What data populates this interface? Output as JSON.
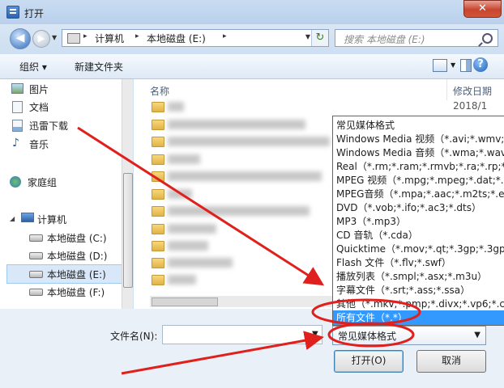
{
  "window": {
    "title": "打开",
    "close_label": "✕"
  },
  "address": {
    "crumbs": [
      "计算机",
      "本地磁盘 (E:)"
    ],
    "search_placeholder": "搜索 本地磁盘 (E:)"
  },
  "toolbar": {
    "organize_label": "组织 ▾",
    "new_folder_label": "新建文件夹"
  },
  "nav": {
    "items": [
      {
        "label": "图片",
        "icon": "pictures-icon"
      },
      {
        "label": "文档",
        "icon": "documents-icon"
      },
      {
        "label": "迅雷下载",
        "icon": "download-icon"
      },
      {
        "label": "音乐",
        "icon": "music-icon"
      },
      {
        "label": "家庭组",
        "icon": "homegroup-icon"
      },
      {
        "label": "计算机",
        "icon": "computer-icon"
      },
      {
        "label": "本地磁盘 (C:)",
        "icon": "drive-icon"
      },
      {
        "label": "本地磁盘 (D:)",
        "icon": "drive-icon"
      },
      {
        "label": "本地磁盘 (E:)",
        "icon": "drive-icon",
        "selected": true
      },
      {
        "label": "本地磁盘 (F:)",
        "icon": "drive-icon"
      }
    ]
  },
  "filelist": {
    "col_name": "名称",
    "col_date": "修改日期",
    "first_date": "2018/1"
  },
  "bottom": {
    "filename_label": "文件名(N):",
    "filter_value": "常见媒体格式",
    "open_label": "打开(O)",
    "cancel_label": "取消"
  },
  "filter_options": [
    "常见媒体格式",
    "Windows Media 视频（*.avi;*.wmv;*.w",
    "Windows Media 音频（*.wma;*.wav;*.",
    "Real（*.rm;*.ram;*.rmvb;*.ra;*.rp;*.smi",
    "MPEG 视频（*.mpg;*.mpeg;*.dat;*.m",
    "MPEG音频（*.mpa;*.aac;*.m2ts;*.evo",
    "DVD（*.vob;*.ifo;*.ac3;*.dts）",
    "MP3（*.mp3）",
    "CD 音轨（*.cda）",
    "Quicktime（*.mov;*.qt;*.3gp;*.3gpp",
    "Flash 文件（*.flv;*.swf）",
    "播放列表（*.smpl;*.asx;*.m3u）",
    "字幕文件（*.srt;*.ass;*.ssa）",
    "其他（*.mkv;*.pmp;*.divx;*.vp6;*.csf;*.",
    "所有文件（*.*）"
  ],
  "selected_option_index": 14,
  "colors": {
    "annotation": "#e0201c",
    "selection": "#3399ff"
  }
}
